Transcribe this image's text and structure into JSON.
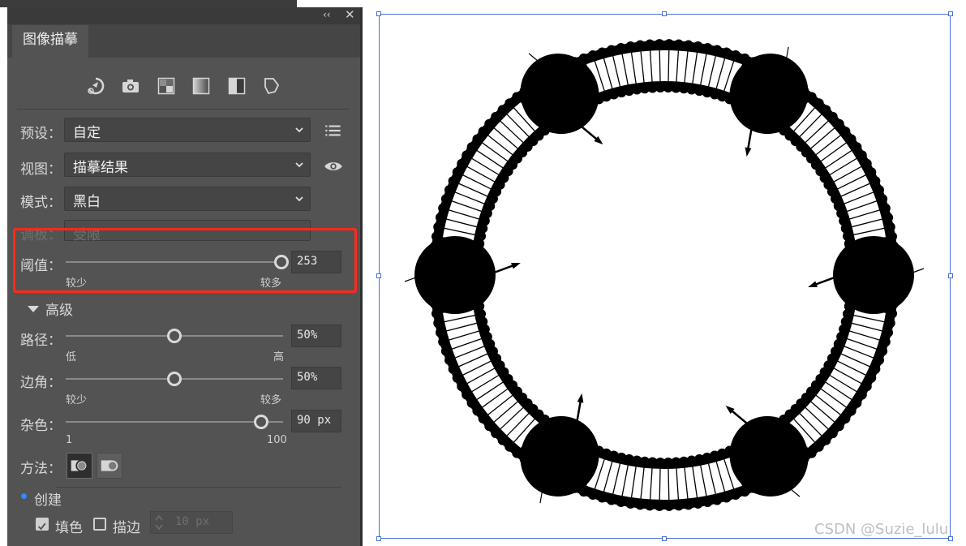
{
  "panel": {
    "title_tab": "图像描摹",
    "collapse_glyph": "‹‹",
    "close_glyph": "✕",
    "top_icons": [
      "auto-color-icon",
      "high-color-photo-icon",
      "low-color-icon",
      "grayscale-icon",
      "black-white-icon",
      "outline-icon"
    ],
    "preset": {
      "label": "预设：",
      "value": "自定"
    },
    "view": {
      "label": "视图：",
      "value": "描摹结果"
    },
    "mode": {
      "label": "模式：",
      "value": "黑白"
    },
    "palette": {
      "label": "调板：",
      "value": "受限"
    },
    "threshold": {
      "label": "阈值：",
      "value": "253",
      "level": 253,
      "min": 1,
      "max": 255,
      "low_label": "较少",
      "high_label": "较多"
    },
    "advanced": {
      "label": "高级"
    },
    "paths": {
      "label": "路径：",
      "value": "50%",
      "level": 50,
      "low_label": "低",
      "high_label": "高"
    },
    "corners": {
      "label": "边角：",
      "value": "50%",
      "level": 50,
      "low_label": "较少",
      "high_label": "较多"
    },
    "noise": {
      "label": "杂色：",
      "value": "90 px",
      "level": 90,
      "min_label": "1",
      "max_label": "100"
    },
    "method": {
      "label": "方法："
    },
    "create": {
      "label": "创建",
      "fill_label": "填色",
      "fill_checked": true,
      "stroke_label": "描边",
      "stroke_checked": false,
      "stroke_value": "10 px"
    },
    "highlight_color": "#ff2a1a",
    "accent": "#2e8bff"
  },
  "canvas": {
    "selection_color": "#4a6ed8",
    "watermark": "CSDN @Suzie_lulu"
  }
}
